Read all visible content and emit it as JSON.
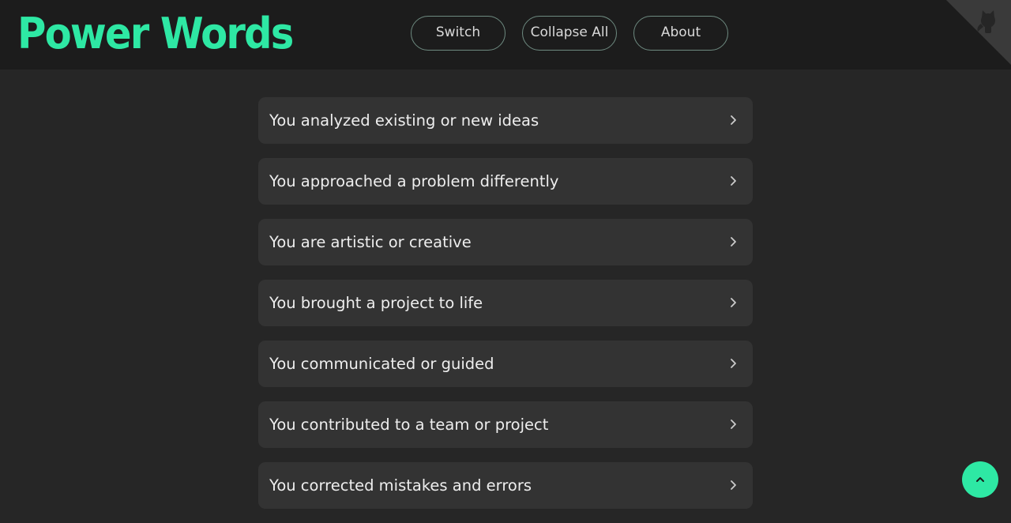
{
  "header": {
    "logo_text": "Power Words",
    "nav": [
      {
        "label": "Switch"
      },
      {
        "label": "Collapse All"
      },
      {
        "label": "About"
      }
    ],
    "corner_icon": "github-octocat-icon"
  },
  "list": {
    "items": [
      {
        "label": "You analyzed existing or new ideas"
      },
      {
        "label": "You approached a problem differently"
      },
      {
        "label": "You are artistic or creative"
      },
      {
        "label": "You brought a project to life"
      },
      {
        "label": "You communicated or guided"
      },
      {
        "label": "You contributed to a team or project"
      },
      {
        "label": "You corrected mistakes and errors"
      }
    ],
    "item_icon": "chevron-right-icon"
  },
  "scroll_top": {
    "icon": "chevron-up-icon"
  },
  "colors": {
    "accent": "#2ee8a4",
    "background": "#262626",
    "header_background": "#1c1c1c",
    "card_background": "#333333"
  }
}
